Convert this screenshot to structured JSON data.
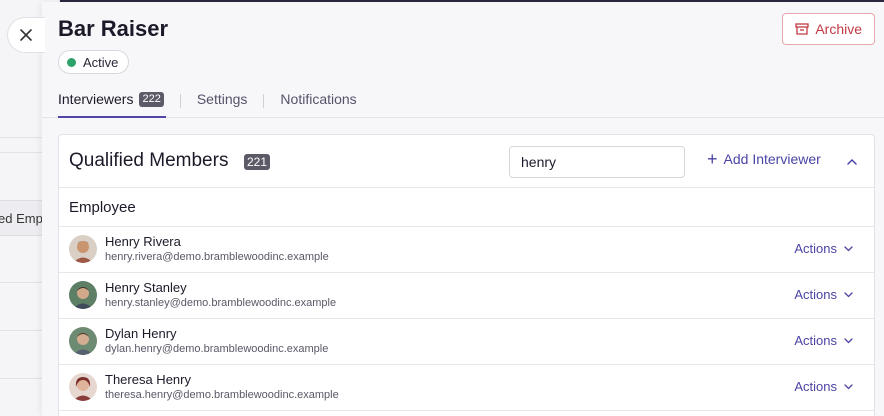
{
  "drawer": {
    "title": "Bar Raiser",
    "status": "Active",
    "archive_label": "Archive",
    "tabs": [
      {
        "label": "Interviewers",
        "count": "222"
      },
      {
        "label": "Settings"
      },
      {
        "label": "Notifications"
      }
    ]
  },
  "background": {
    "cell_text": "ed Empl"
  },
  "members": {
    "title": "Qualified Members",
    "count": "221",
    "search_value": "henry",
    "add_label": "Add Interviewer",
    "group_label": "Employee",
    "actions_label": "Actions",
    "rows": [
      {
        "name": "Henry Rivera",
        "email": "henry.rivera@demo.bramblewoodinc.example"
      },
      {
        "name": "Henry Stanley",
        "email": "henry.stanley@demo.bramblewoodinc.example"
      },
      {
        "name": "Dylan Henry",
        "email": "dylan.henry@demo.bramblewoodinc.example"
      },
      {
        "name": "Theresa Henry",
        "email": "theresa.henry@demo.bramblewoodinc.example"
      }
    ]
  },
  "colors": {
    "accent": "#4b44a6",
    "status_active": "#2ea36a",
    "archive": "#c23a45"
  }
}
